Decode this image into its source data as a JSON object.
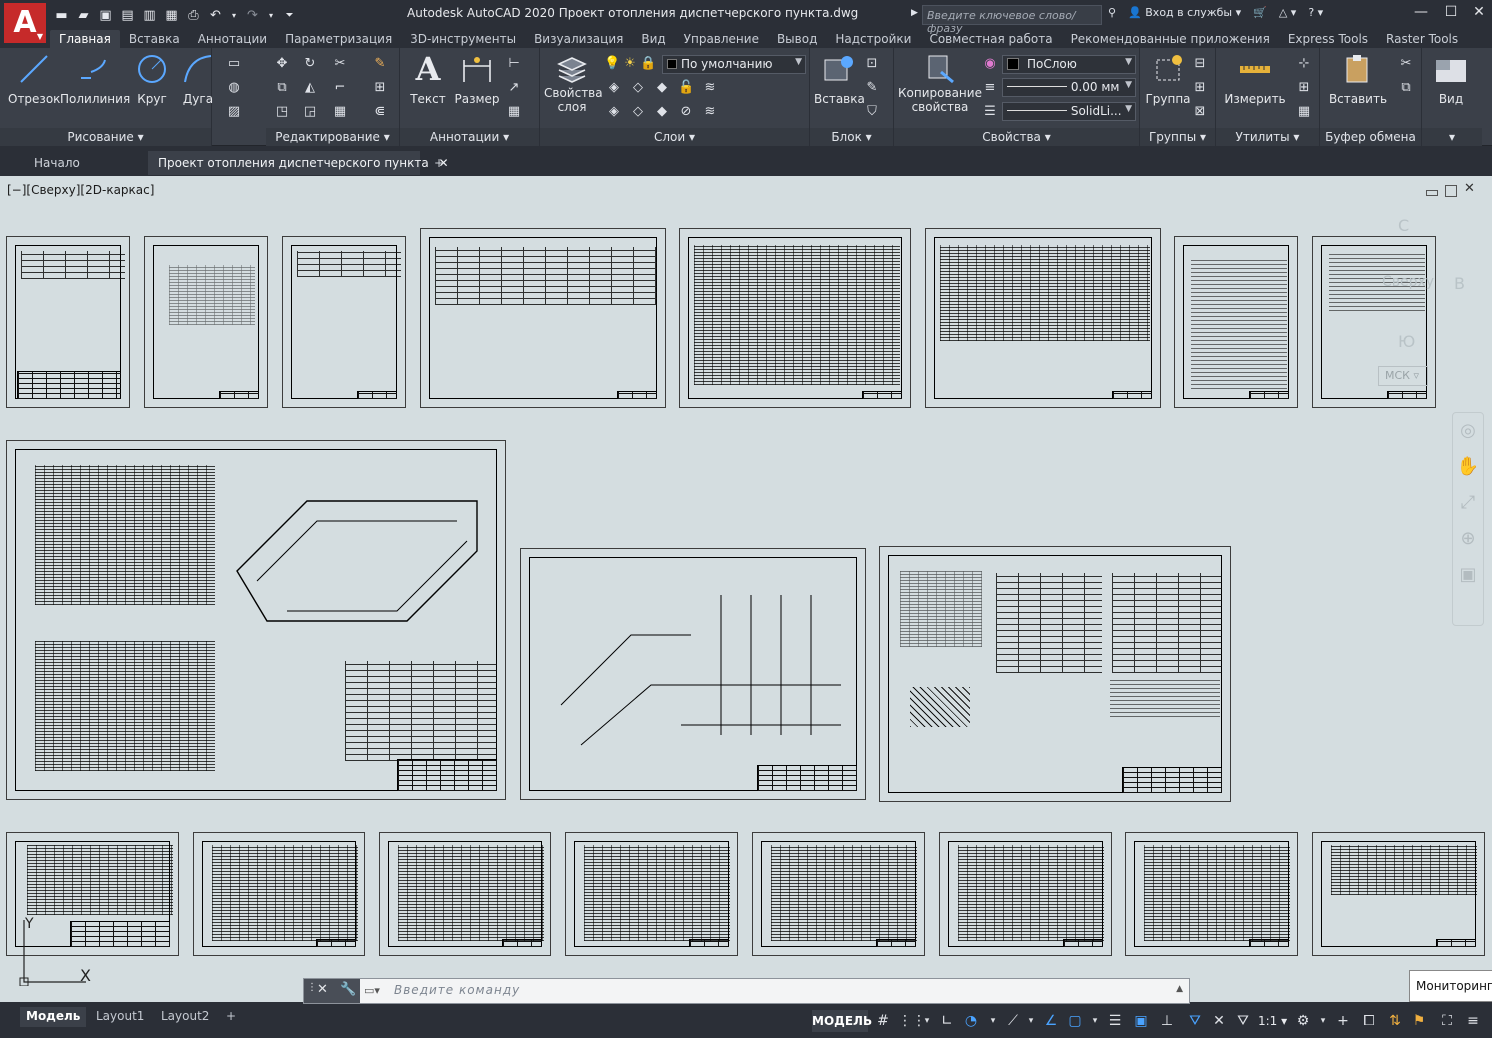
{
  "app": {
    "logo_letter": "A",
    "title": "Autodesk AutoCAD 2020   Проект отопления диспетчерского пункта.dwg",
    "search_placeholder": "Введите ключевое слово/фразу",
    "signin": "Вход в службы",
    "colors": {
      "chrome": "#2b2f37",
      "ribbon": "#3b4049",
      "canvas": "#d4dde0",
      "logo": "#c62a2a"
    }
  },
  "ribbon_tabs": [
    "Главная",
    "Вставка",
    "Аннотации",
    "Параметризация",
    "3D-инструменты",
    "Визуализация",
    "Вид",
    "Управление",
    "Вывод",
    "Надстройки",
    "Совместная работа",
    "Рекомендованные приложения",
    "Express Tools",
    "Raster Tools"
  ],
  "ribbon": {
    "draw": {
      "title": "Рисование",
      "line": "Отрезок",
      "polyline": "Полилиния",
      "circle": "Круг",
      "arc": "Дуга"
    },
    "modify": {
      "title": "Редактирование"
    },
    "annotation": {
      "title": "Аннотации",
      "text": "Текст",
      "dimension": "Размер"
    },
    "layers": {
      "title": "Слои",
      "layer_props_1": "Свойства",
      "layer_props_2": "слоя",
      "current_layer": "По умолчанию"
    },
    "block": {
      "title": "Блок",
      "insert": "Вставка"
    },
    "properties": {
      "title": "Свойства",
      "match_1": "Копирование",
      "match_2": "свойства",
      "color": "ПоСлою",
      "lineweight": "0.00 мм",
      "linetype": "SolidLi..."
    },
    "groups": {
      "title": "Группы",
      "group": "Группа"
    },
    "utilities": {
      "title": "Утилиты",
      "measure": "Измерить"
    },
    "clipboard": {
      "title": "Буфер обмена",
      "paste": "Вставить"
    },
    "view": {
      "title": "Вид"
    }
  },
  "file_tabs": {
    "start": "Начало",
    "current": "Проект отопления диспетчерского пункта",
    "close": "✕",
    "add": "+"
  },
  "viewport": {
    "label": "[−][Сверху][2D-каркас]",
    "viewcube": {
      "north": "С",
      "east": "В",
      "south": "Ю",
      "top": "Сверху"
    },
    "ucs_combo": "МСК",
    "ucs_x": "X",
    "ucs_y": "Y"
  },
  "command": {
    "placeholder": "Введите команду"
  },
  "tooltip": "Мониторинг с",
  "status": {
    "layout_tabs": [
      "Модель",
      "Layout1",
      "Layout2"
    ],
    "add": "+",
    "space": "МОДЕЛЬ",
    "scale": "1:1"
  }
}
